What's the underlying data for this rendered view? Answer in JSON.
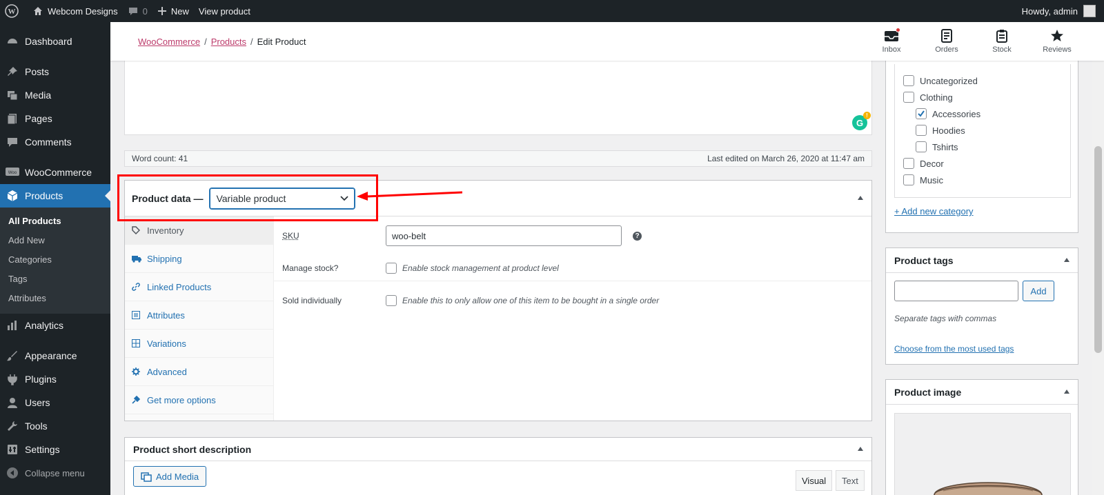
{
  "adminbar": {
    "site_name": "Webcom Designs",
    "comments_count": "0",
    "new_label": "New",
    "view_label": "View product",
    "greeting": "Howdy, admin"
  },
  "sidebar": {
    "items": [
      {
        "label": "Dashboard",
        "icon": "dashboard-icon"
      },
      {
        "label": "Posts",
        "icon": "pin-icon"
      },
      {
        "label": "Media",
        "icon": "media-icon"
      },
      {
        "label": "Pages",
        "icon": "page-icon"
      },
      {
        "label": "Comments",
        "icon": "comment-icon"
      },
      {
        "label": "WooCommerce",
        "icon": "woo-icon"
      },
      {
        "label": "Products",
        "icon": "box-icon"
      },
      {
        "label": "Analytics",
        "icon": "bar-chart-icon"
      },
      {
        "label": "Appearance",
        "icon": "brush-icon"
      },
      {
        "label": "Plugins",
        "icon": "plugin-icon"
      },
      {
        "label": "Users",
        "icon": "user-icon"
      },
      {
        "label": "Tools",
        "icon": "wrench-icon"
      },
      {
        "label": "Settings",
        "icon": "settings-icon"
      },
      {
        "label": "Collapse menu",
        "icon": "collapse-icon"
      }
    ],
    "submenu": [
      "All Products",
      "Add New",
      "Categories",
      "Tags",
      "Attributes"
    ]
  },
  "header": {
    "breadcrumb": [
      "WooCommerce",
      "Products",
      "Edit Product"
    ],
    "icons": [
      {
        "label": "Inbox",
        "icon": "inbox-icon"
      },
      {
        "label": "Orders",
        "icon": "orders-icon"
      },
      {
        "label": "Stock",
        "icon": "stock-icon"
      },
      {
        "label": "Reviews",
        "icon": "star-icon"
      }
    ]
  },
  "editor": {
    "word_count": "Word count: 41",
    "last_edited": "Last edited on March 26, 2020 at 11:47 am"
  },
  "product_data": {
    "title": "Product data —",
    "type_selected": "Variable product",
    "tabs": [
      {
        "label": "Inventory",
        "icon": "tag-icon"
      },
      {
        "label": "Shipping",
        "icon": "truck-icon"
      },
      {
        "label": "Linked Products",
        "icon": "link-icon"
      },
      {
        "label": "Attributes",
        "icon": "list-icon"
      },
      {
        "label": "Variations",
        "icon": "grid-icon"
      },
      {
        "label": "Advanced",
        "icon": "gear-icon"
      },
      {
        "label": "Get more options",
        "icon": "plug-icon"
      }
    ],
    "sku_label": "SKU",
    "sku_value": "woo-belt",
    "manage_stock_label": "Manage stock?",
    "manage_stock_desc": "Enable stock management at product level",
    "sold_individually_label": "Sold individually",
    "sold_individually_desc": "Enable this to only allow one of this item to be bought in a single order"
  },
  "short_description": {
    "title": "Product short description",
    "add_media": "Add Media",
    "tab_visual": "Visual",
    "tab_text": "Text"
  },
  "categories": {
    "items": [
      {
        "label": "Uncategorized",
        "checked": false
      },
      {
        "label": "Clothing",
        "checked": false
      },
      {
        "label": "Accessories",
        "checked": true
      },
      {
        "label": "Hoodies",
        "checked": false
      },
      {
        "label": "Tshirts",
        "checked": false
      },
      {
        "label": "Decor",
        "checked": false
      },
      {
        "label": "Music",
        "checked": false
      }
    ],
    "add_new": "+ Add new category"
  },
  "tags": {
    "title": "Product tags",
    "add_button": "Add",
    "hint": "Separate tags with commas",
    "choose_link": "Choose from the most used tags"
  },
  "product_image": {
    "title": "Product image"
  },
  "colors": {
    "admin_dark": "#1d2327",
    "active_blue": "#2271b1",
    "woo_link": "#bc3a6a",
    "annotation_red": "#ff0000"
  }
}
